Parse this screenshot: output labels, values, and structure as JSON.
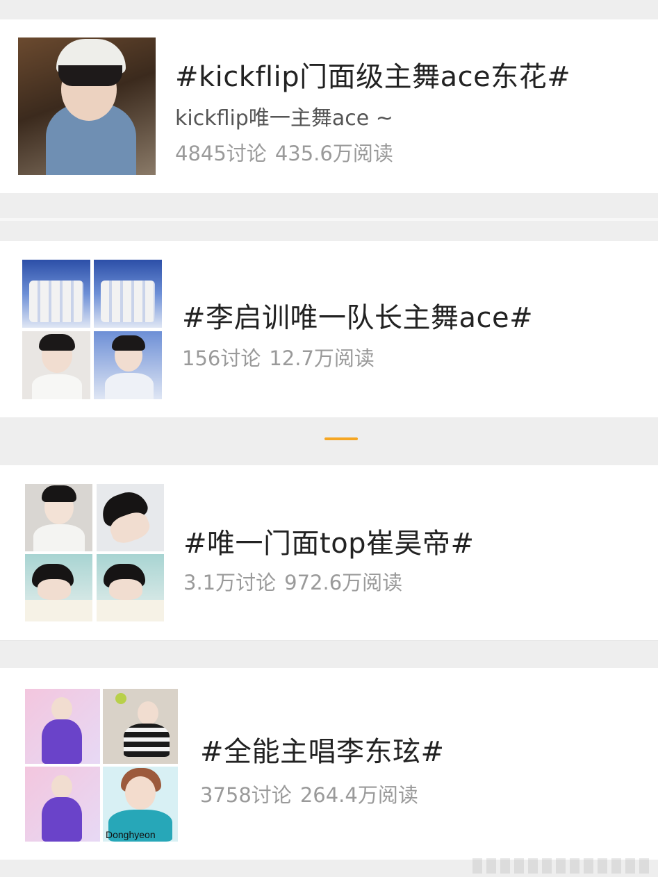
{
  "topics": [
    {
      "title": "#kickflip门面级主舞ace东花#",
      "subtitle": "kickflip唯一主舞ace ~",
      "discussions": "4845讨论",
      "reads": "435.6万阅读"
    },
    {
      "title": "#李启训唯一队长主舞ace#",
      "discussions": "156讨论",
      "reads": "12.7万阅读"
    },
    {
      "title": "#唯一门面top崔昊帝#",
      "discussions": "3.1万讨论",
      "reads": "972.6万阅读"
    },
    {
      "title": "#全能主唱李东玹#",
      "discussions": "3758讨论",
      "reads": "264.4万阅读",
      "image_caption": "Donghyeon"
    }
  ],
  "colors": {
    "background": "#eeeeee",
    "card": "#ffffff",
    "title_text": "#222222",
    "stats_text": "#9a9a9a",
    "indicator": "#f5a623"
  }
}
